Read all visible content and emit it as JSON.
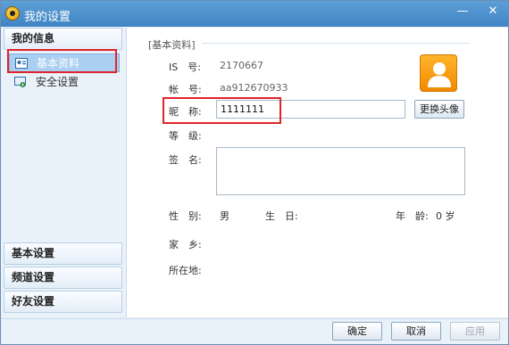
{
  "window": {
    "title": "我的设置",
    "minimize": "—",
    "close": "✕"
  },
  "sidebar": {
    "my_info_header": "我的信息",
    "items": [
      {
        "label": "基本资料",
        "icon": "profile-card-icon"
      },
      {
        "label": "安全设置",
        "icon": "security-icon"
      }
    ],
    "basic_settings": "基本设置",
    "channel_settings": "频道设置",
    "friend_settings": "好友设置"
  },
  "profile": {
    "section_title": "[基本资料]",
    "is_label": "IS　号:",
    "is_value": "2170667",
    "account_label": "帐　号:",
    "account_value": "aa912670933",
    "nickname_label": "昵　称:",
    "nickname_value": "1111111",
    "level_label": "等　级:",
    "signature_label": "签　名:",
    "gender_label": "性　别:",
    "gender_value": "男",
    "birthday_label": "生　日:",
    "age_label": "年　龄:",
    "age_value": "0 岁",
    "hometown_label": "家　乡:",
    "location_label": "所在地:",
    "change_avatar_button": "更换头像"
  },
  "footer": {
    "ok": "确定",
    "cancel": "取消",
    "apply": "应用"
  },
  "colors": {
    "accent": "#3f84c4",
    "highlight": "#e0242a"
  }
}
